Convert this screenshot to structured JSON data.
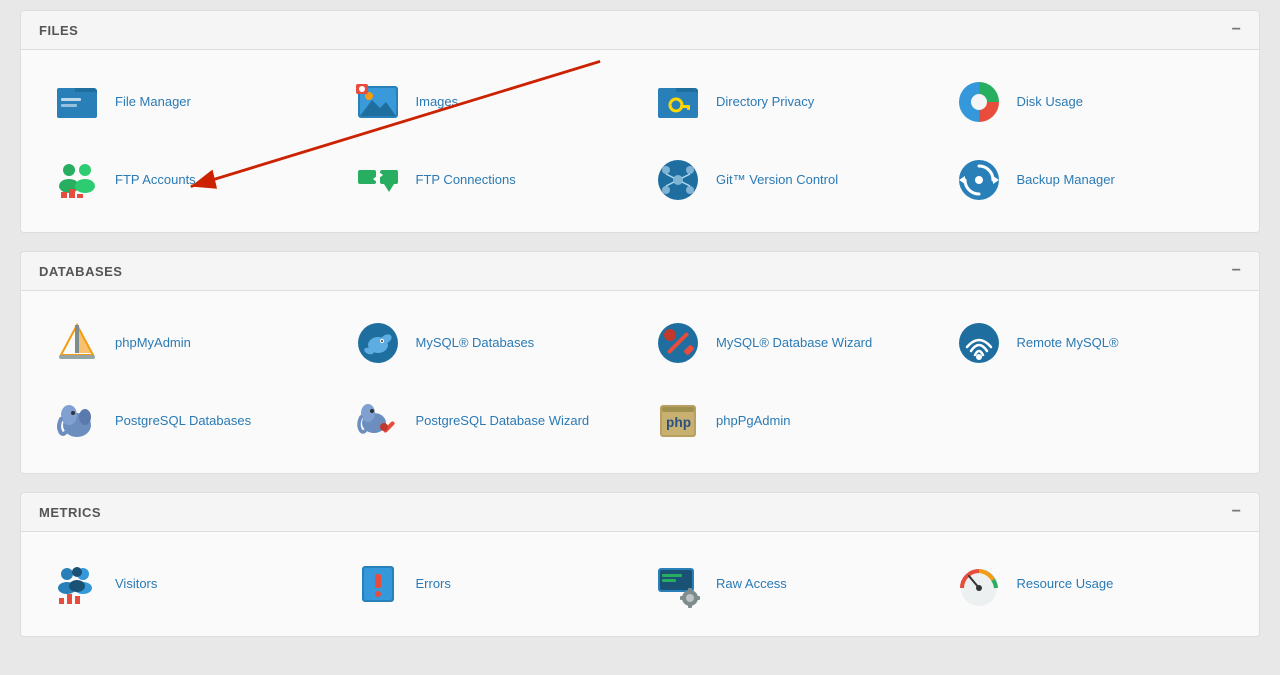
{
  "sections": [
    {
      "id": "files",
      "title": "FILES",
      "items": [
        {
          "id": "file-manager",
          "label": "File Manager",
          "icon": "file-manager"
        },
        {
          "id": "images",
          "label": "Images",
          "icon": "images"
        },
        {
          "id": "directory-privacy",
          "label": "Directory Privacy",
          "icon": "directory-privacy"
        },
        {
          "id": "disk-usage",
          "label": "Disk Usage",
          "icon": "disk-usage"
        },
        {
          "id": "ftp-accounts",
          "label": "FTP Accounts",
          "icon": "ftp-accounts"
        },
        {
          "id": "ftp-connections",
          "label": "FTP Connections",
          "icon": "ftp-connections"
        },
        {
          "id": "git-version-control",
          "label": "Git™ Version Control",
          "icon": "git-version-control"
        },
        {
          "id": "backup-manager",
          "label": "Backup Manager",
          "icon": "backup-manager"
        }
      ]
    },
    {
      "id": "databases",
      "title": "DATABASES",
      "items": [
        {
          "id": "phpmyadmin",
          "label": "phpMyAdmin",
          "icon": "phpmyadmin"
        },
        {
          "id": "mysql-databases",
          "label": "MySQL® Databases",
          "icon": "mysql-databases"
        },
        {
          "id": "mysql-database-wizard",
          "label": "MySQL® Database Wizard",
          "icon": "mysql-database-wizard"
        },
        {
          "id": "remote-mysql",
          "label": "Remote MySQL®",
          "icon": "remote-mysql"
        },
        {
          "id": "postgresql-databases",
          "label": "PostgreSQL Databases",
          "icon": "postgresql-databases"
        },
        {
          "id": "postgresql-database-wizard",
          "label": "PostgreSQL Database Wizard",
          "icon": "postgresql-database-wizard"
        },
        {
          "id": "phppgadmin",
          "label": "phpPgAdmin",
          "icon": "phppgadmin"
        }
      ]
    },
    {
      "id": "metrics",
      "title": "METRICS",
      "items": [
        {
          "id": "visitors",
          "label": "Visitors",
          "icon": "visitors"
        },
        {
          "id": "errors",
          "label": "Errors",
          "icon": "errors"
        },
        {
          "id": "raw-access",
          "label": "Raw Access",
          "icon": "raw-access"
        },
        {
          "id": "resource-usage",
          "label": "Resource Usage",
          "icon": "resource-usage"
        }
      ]
    }
  ],
  "arrow": {
    "color": "#cc2200"
  }
}
